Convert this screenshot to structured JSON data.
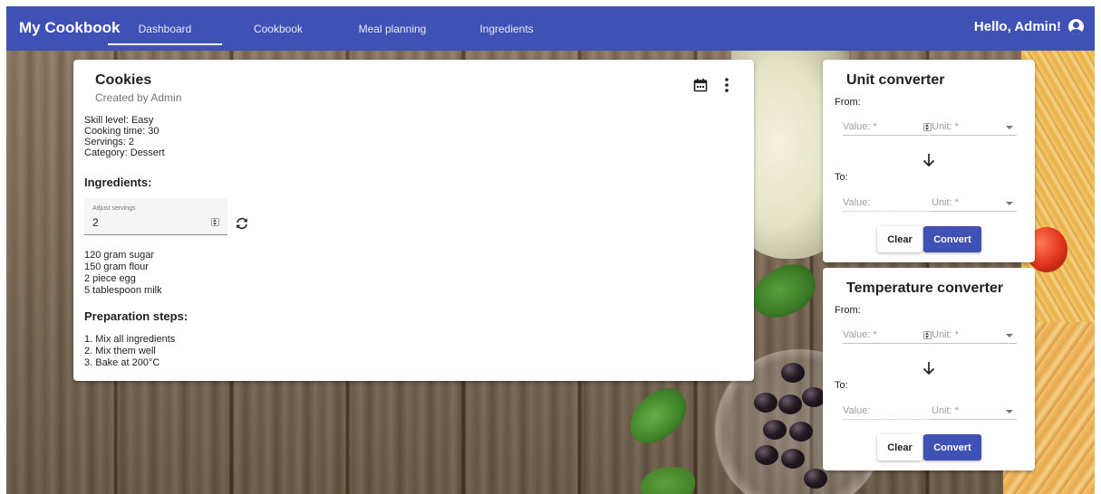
{
  "app": {
    "brand": "My Cookbook",
    "greeting": "Hello, Admin!",
    "primary_color": "#3f51b5"
  },
  "nav": {
    "tabs": [
      {
        "label": "Dashboard",
        "active": true
      },
      {
        "label": "Cookbook",
        "active": false
      },
      {
        "label": "Meal planning",
        "active": false
      },
      {
        "label": "Ingredients",
        "active": false
      }
    ]
  },
  "recipe": {
    "title": "Cookies",
    "subtitle": "Created by Admin",
    "skill": "Skill level: Easy",
    "cooking_time": "Cooking time: 30",
    "servings": "Servings: 2",
    "category": "Category: Dessert",
    "ingredients_heading": "Ingredients:",
    "adjust_label": "Adjust servings",
    "adjust_value": "2",
    "ingredients": [
      "120 gram sugar",
      "150 gram flour",
      "2 piece egg",
      "5 tablespoon milk"
    ],
    "steps_heading": "Preparation steps:",
    "steps": [
      "1. Mix all ingredients",
      "2. Mix them well",
      "3. Bake at 200°C"
    ]
  },
  "unit_converter": {
    "title": "Unit converter",
    "from_label": "From:",
    "to_label": "To:",
    "from_value_placeholder": "Value: *",
    "from_unit_placeholder": "Unit: *",
    "to_value_placeholder": "Value:",
    "to_unit_placeholder": "Unit: *",
    "clear_label": "Clear",
    "convert_label": "Convert"
  },
  "temperature_converter": {
    "title": "Temperature converter",
    "from_label": "From:",
    "to_label": "To:",
    "from_value_placeholder": "Value: *",
    "from_unit_placeholder": "Unit: *",
    "to_value_placeholder": "Value:",
    "to_unit_placeholder": "Unit: *",
    "clear_label": "Clear",
    "convert_label": "Convert"
  }
}
